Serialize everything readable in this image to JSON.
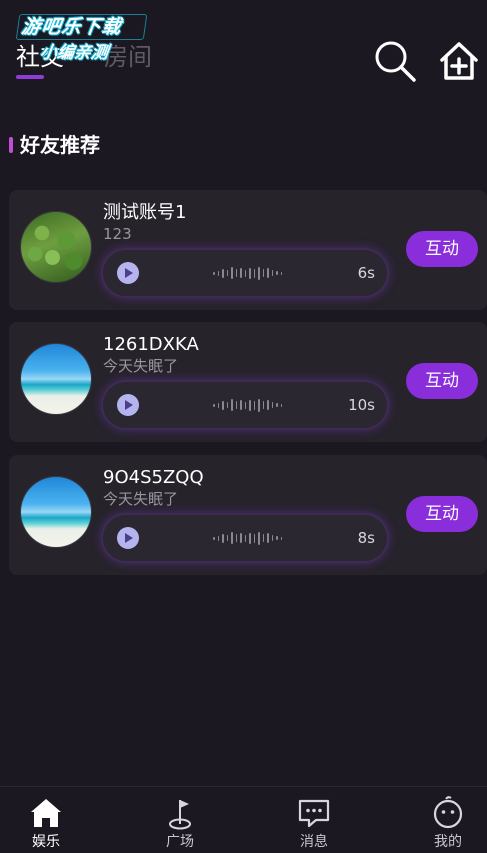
{
  "header": {
    "tabs": [
      {
        "label": "社交",
        "active": true
      },
      {
        "label": "房间",
        "active": false
      }
    ],
    "watermark": {
      "line1": "游吧乐下载",
      "line2": "小编亲测"
    },
    "icons": [
      "search-icon",
      "home-add-icon"
    ]
  },
  "section": {
    "title": "好友推荐"
  },
  "friends": [
    {
      "name": "测试账号1",
      "subtitle": "123",
      "duration": "6s",
      "action": "互动",
      "avatar": "plant"
    },
    {
      "name": "1261DXKA",
      "subtitle": "今天失眠了",
      "duration": "10s",
      "action": "互动",
      "avatar": "beach"
    },
    {
      "name": "9O4S5ZQQ",
      "subtitle": "今天失眠了",
      "duration": "8s",
      "action": "互动",
      "avatar": "beach"
    }
  ],
  "bottom_nav": {
    "items": [
      {
        "label": "娱乐",
        "icon": "home-icon",
        "active": true
      },
      {
        "label": "广场",
        "icon": "flag-icon",
        "active": false
      },
      {
        "label": "消息",
        "icon": "chat-icon",
        "active": false
      },
      {
        "label": "我的",
        "icon": "smiley-icon",
        "active": false
      }
    ]
  },
  "colors": {
    "background": "#1b1821",
    "card": "#26232b",
    "accent": "#8a2ddb",
    "section_bar": "#c04fd6"
  }
}
